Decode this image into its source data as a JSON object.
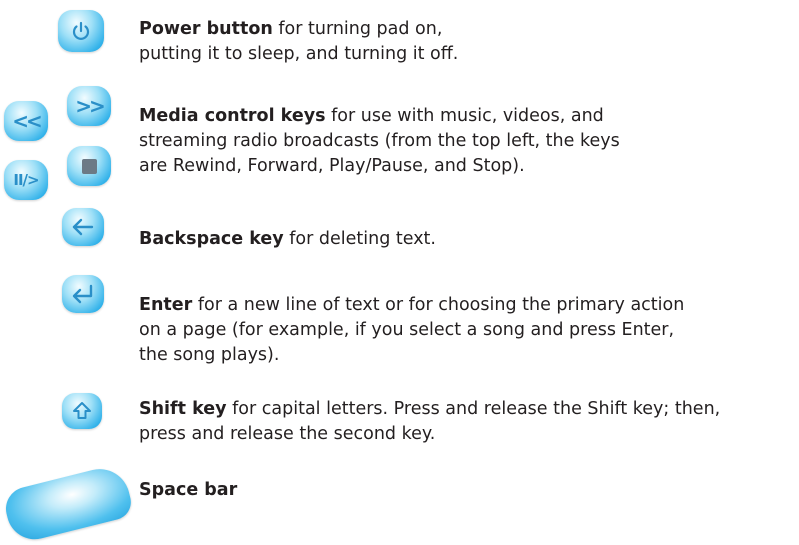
{
  "power": {
    "title": "Power button",
    "line1_rest": " for turning pad on,",
    "line2": "putting it to sleep, and turning it off."
  },
  "media": {
    "title": "Media control keys",
    "line1_rest": " for use with music, videos, and",
    "line2": "streaming radio broadcasts (from the top left, the keys",
    "line3": "are Rewind, Forward, Play/Pause, and Stop).",
    "rewind_glyph": "<<",
    "forward_glyph": ">>",
    "playpause_glyph": "II/>"
  },
  "backspace": {
    "title": "Backspace key",
    "line1_rest": " for deleting text."
  },
  "enter": {
    "title": "Enter",
    "line1_rest": " for a new line of text or for choosing the primary action",
    "line2": "on a page (for example, if you select a song and press Enter,",
    "line3": "the song plays)."
  },
  "shift": {
    "title": "Shift key",
    "line1_rest": " for capital letters. Press and release the Shift key; then,",
    "line2": "press and release the second key."
  },
  "spacebar": {
    "title": "Space bar"
  },
  "colors": {
    "key_light": "#9fe0f7",
    "key_dark": "#1f9fdc",
    "glyph": "#2a8fc8",
    "text": "#231f20"
  }
}
